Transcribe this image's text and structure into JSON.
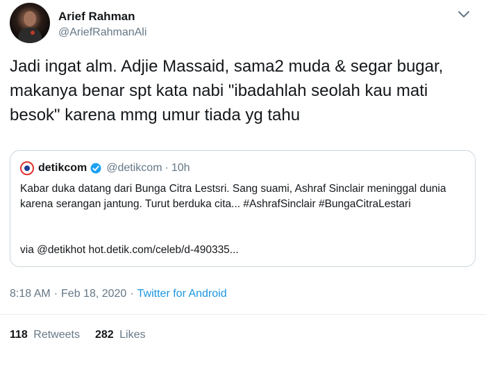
{
  "author": {
    "name": "Arief Rahman",
    "handle": "@AriefRahmanAli"
  },
  "tweet": {
    "text": "Jadi ingat alm. Adjie Massaid, sama2 muda & segar bugar, makanya benar spt kata nabi \"ibadahlah seolah kau mati besok\" karena mmg umur tiada yg tahu"
  },
  "quote": {
    "name": "detikcom",
    "handle": "@detikcom",
    "separator": "·",
    "time": "10h",
    "body": "Kabar duka datang dari Bunga Citra Lestsri. Sang suami, Ashraf Sinclair meninggal dunia karena serangan jantung. Turut berduka cita... #AshrafSinclair #BungaCitraLestari",
    "via": "via @detikhot hot.detik.com/celeb/d-490335..."
  },
  "meta": {
    "time": "8:18 AM",
    "separator": "·",
    "date": "Feb 18, 2020",
    "source": "Twitter for Android"
  },
  "stats": {
    "retweets_count": "118",
    "retweets_label": "Retweets",
    "likes_count": "282",
    "likes_label": "Likes"
  },
  "colors": {
    "link": "#1b95e0",
    "secondary_text": "#657786",
    "border": "#ccd6dd",
    "verified": "#1da1f2"
  },
  "icons": {
    "menu": "chevron-down-icon",
    "verified": "verified-badge-icon",
    "quote_logo": "detik-logo-icon"
  }
}
